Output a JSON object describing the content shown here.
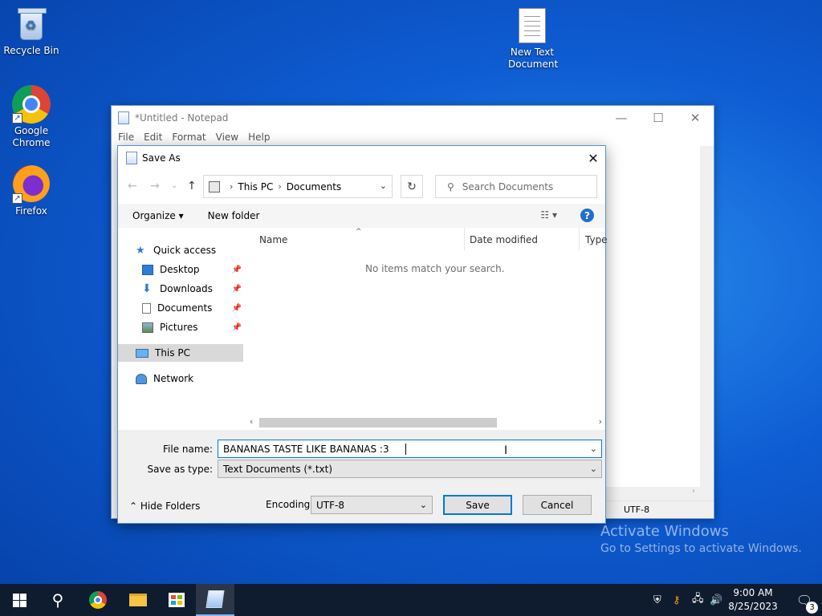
{
  "desktop": {
    "icons": [
      {
        "label": "Recycle Bin"
      },
      {
        "label": "Google Chrome"
      },
      {
        "label": "Firefox"
      },
      {
        "label": "New Text Document"
      }
    ]
  },
  "notepad": {
    "title": "*Untitled - Notepad",
    "menu": [
      "File",
      "Edit",
      "Format",
      "View",
      "Help"
    ],
    "status_encoding": "UTF-8"
  },
  "dialog": {
    "title": "Save As",
    "breadcrumb": [
      "This PC",
      "Documents"
    ],
    "search_placeholder": "Search Documents",
    "toolbar": {
      "organize": "Organize",
      "new_folder": "New folder"
    },
    "nav": {
      "quick_access": "Quick access",
      "items": [
        "Desktop",
        "Downloads",
        "Documents",
        "Pictures"
      ],
      "this_pc": "This PC",
      "network": "Network"
    },
    "columns": [
      "Name",
      "Date modified",
      "Type"
    ],
    "empty_message": "No items match your search.",
    "file_name_label": "File name:",
    "file_name_value": "BANANAS TASTE LIKE BANANAS :3",
    "save_type_label": "Save as type:",
    "save_type_value": "Text Documents (*.txt)",
    "hide_folders": "Hide Folders",
    "encoding_label": "Encoding:",
    "encoding_value": "UTF-8",
    "save_label": "Save",
    "cancel_label": "Cancel"
  },
  "watermark": {
    "line1": "Activate Windows",
    "line2": "Go to Settings to activate Windows."
  },
  "taskbar": {
    "time": "9:00 AM",
    "date": "8/25/2023",
    "notification_count": "3"
  }
}
